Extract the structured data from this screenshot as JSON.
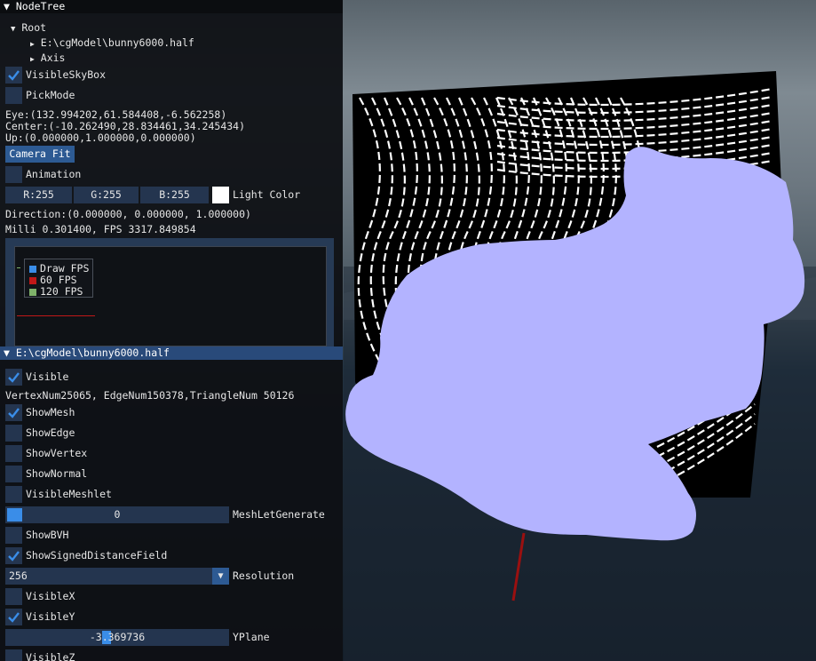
{
  "nodetree": {
    "title": "NodeTree",
    "root_label": "Root",
    "children": [
      "E:\\cgModel\\bunny6000.half",
      "Axis"
    ],
    "visible_skybox": {
      "label": "VisibleSkyBox",
      "checked": true
    },
    "pick_mode": {
      "label": "PickMode",
      "checked": false
    },
    "eye": "Eye:(132.994202,61.584408,-6.562258)",
    "center": "Center:(-10.262490,28.834461,34.245434)",
    "up": "Up:(0.000000,1.000000,0.000000)",
    "camera_fit_label": "Camera Fit",
    "animation": {
      "label": "Animation",
      "checked": false
    },
    "light": {
      "r": "R:255",
      "g": "G:255",
      "b": "B:255",
      "label": "Light Color",
      "swatch": "#ffffff"
    },
    "direction": "Direction:(0.000000, 0.000000, 1.000000)",
    "stats": "Milli 0.301400, FPS 3317.849854",
    "legend": [
      {
        "label": "Draw FPS",
        "color": "#3a8de8"
      },
      {
        "label": "60 FPS",
        "color": "#c01818"
      },
      {
        "label": "120 FPS",
        "color": "#7fb26a"
      }
    ]
  },
  "model": {
    "title": "E:\\cgModel\\bunny6000.half",
    "visible": {
      "label": "Visible",
      "checked": true
    },
    "counts": "VertexNum25065, EdgeNum150378,TriangleNum 50126",
    "show_mesh": {
      "label": "ShowMesh",
      "checked": true
    },
    "show_edge": {
      "label": "ShowEdge",
      "checked": false
    },
    "show_vertex": {
      "label": "ShowVertex",
      "checked": false
    },
    "show_normal": {
      "label": "ShowNormal",
      "checked": false
    },
    "visible_meshlet": {
      "label": "VisibleMeshlet",
      "checked": false
    },
    "meshlet_generate": {
      "value": "0",
      "label": "MeshLetGenerate",
      "fraction": 0.0
    },
    "show_bvh": {
      "label": "ShowBVH",
      "checked": false
    },
    "show_sdf": {
      "label": "ShowSignedDistanceField",
      "checked": true
    },
    "resolution": {
      "value": "256",
      "label": "Resolution"
    },
    "visible_x": {
      "label": "VisibleX",
      "checked": false
    },
    "visible_y": {
      "label": "VisibleY",
      "checked": true
    },
    "yplane": {
      "value": "-3.369736",
      "label": "YPlane"
    },
    "visible_z": {
      "label": "VisibleZ",
      "checked": false
    }
  },
  "colors": {
    "accent": "#2d5a93",
    "frame": "#24354f",
    "check": "#3a8de8",
    "bunny": "#b3b3ff"
  }
}
